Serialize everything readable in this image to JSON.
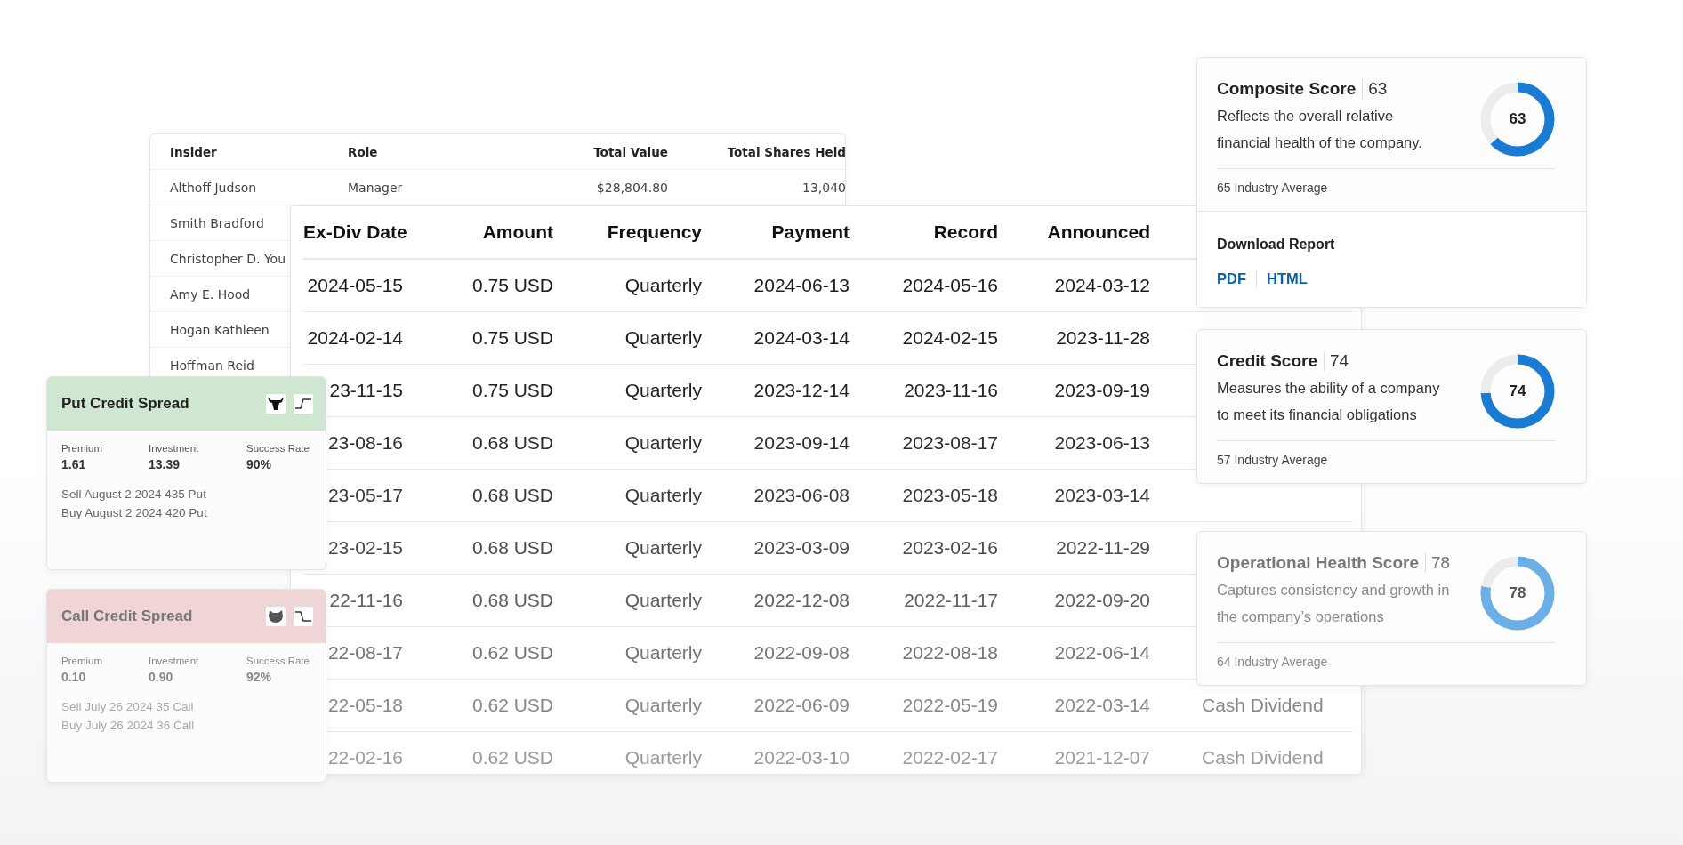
{
  "insider_table": {
    "columns": [
      "Insider",
      "Role",
      "Total Value",
      "Total Shares Held"
    ],
    "rows": [
      {
        "cells": [
          "Althoff Judson",
          "Manager",
          "$28,804.80",
          "13,040"
        ]
      },
      {
        "cells": [
          "Smith Bradford"
        ]
      },
      {
        "cells": [
          "Christopher D. You"
        ]
      },
      {
        "cells": [
          "Amy E. Hood"
        ]
      },
      {
        "cells": [
          "Hogan Kathleen"
        ]
      },
      {
        "cells": [
          "Hoffman Reid"
        ]
      }
    ]
  },
  "dividend_table": {
    "columns": [
      "Ex-Div Date",
      "Amount",
      "Frequency",
      "Payment",
      "Record",
      "Announced"
    ],
    "rows": [
      {
        "cells": [
          "2024-05-15",
          "0.75 USD",
          "Quarterly",
          "2024-06-13",
          "2024-05-16",
          "2024-03-12"
        ]
      },
      {
        "cells": [
          "2024-02-14",
          "0.75 USD",
          "Quarterly",
          "2024-03-14",
          "2024-02-15",
          "2023-11-28"
        ]
      },
      {
        "cells": [
          "23-11-15",
          "0.75 USD",
          "Quarterly",
          "2023-12-14",
          "2023-11-16",
          "2023-09-19"
        ]
      },
      {
        "cells": [
          "23-08-16",
          "0.68 USD",
          "Quarterly",
          "2023-09-14",
          "2023-08-17",
          "2023-06-13"
        ]
      },
      {
        "cells": [
          "23-05-17",
          "0.68 USD",
          "Quarterly",
          "2023-06-08",
          "2023-05-18",
          "2023-03-14"
        ]
      },
      {
        "cells": [
          "23-02-15",
          "0.68 USD",
          "Quarterly",
          "2023-03-09",
          "2023-02-16",
          "2022-11-29"
        ]
      },
      {
        "cells": [
          "22-11-16",
          "0.68 USD",
          "Quarterly",
          "2022-12-08",
          "2022-11-17",
          "2022-09-20"
        ]
      },
      {
        "cells": [
          "22-08-17",
          "0.62 USD",
          "Quarterly",
          "2022-09-08",
          "2022-08-18",
          "2022-06-14"
        ]
      },
      {
        "cells": [
          "22-05-18",
          "0.62 USD",
          "Quarterly",
          "2022-06-09",
          "2022-05-19",
          "2022-03-14",
          "Cash Dividend"
        ]
      },
      {
        "cells": [
          "22-02-16",
          "0.62 USD",
          "Quarterly",
          "2022-03-10",
          "2022-02-17",
          "2021-12-07",
          "Cash Dividend"
        ]
      }
    ]
  },
  "spread_cards": [
    {
      "kind": "put",
      "title": "Put Credit Spread",
      "stats": [
        {
          "label": "Premium",
          "value": "1.61"
        },
        {
          "label": "Investment",
          "value": "13.39"
        },
        {
          "label": "Success Rate",
          "value": "90%"
        }
      ],
      "legs": [
        "Sell August 2 2024 435 Put",
        "Buy August 2 2024 420 Put"
      ]
    },
    {
      "kind": "call",
      "title": "Call Credit Spread",
      "stats": [
        {
          "label": "Premium",
          "value": "0.10"
        },
        {
          "label": "Investment",
          "value": "0.90"
        },
        {
          "label": "Success Rate",
          "value": "92%"
        }
      ],
      "legs": [
        "Sell July 26 2024 35 Call",
        "Buy July 26 2024 36 Call"
      ]
    }
  ],
  "score_cards": [
    {
      "title": "Composite Score",
      "score": "63",
      "description": "Reflects the overall relative financial health of the company.",
      "level": 0.63,
      "gauge_label": "63",
      "industry_average": "65 Industry Average",
      "download": {
        "title": "Download Report",
        "links": [
          "PDF",
          "HTML"
        ]
      }
    },
    {
      "title": "Credit Score",
      "score": "74",
      "description": "Measures the ability of a company to meet its financial obligations",
      "level": 0.74,
      "gauge_label": "74",
      "industry_average": "57 Industry Average"
    },
    {
      "title": "Operational Health Score",
      "score": "78",
      "description": "Captures consistency and growth in the company’s operations",
      "level": 0.78,
      "gauge_label": "78",
      "industry_average": "64 Industry Average"
    }
  ]
}
